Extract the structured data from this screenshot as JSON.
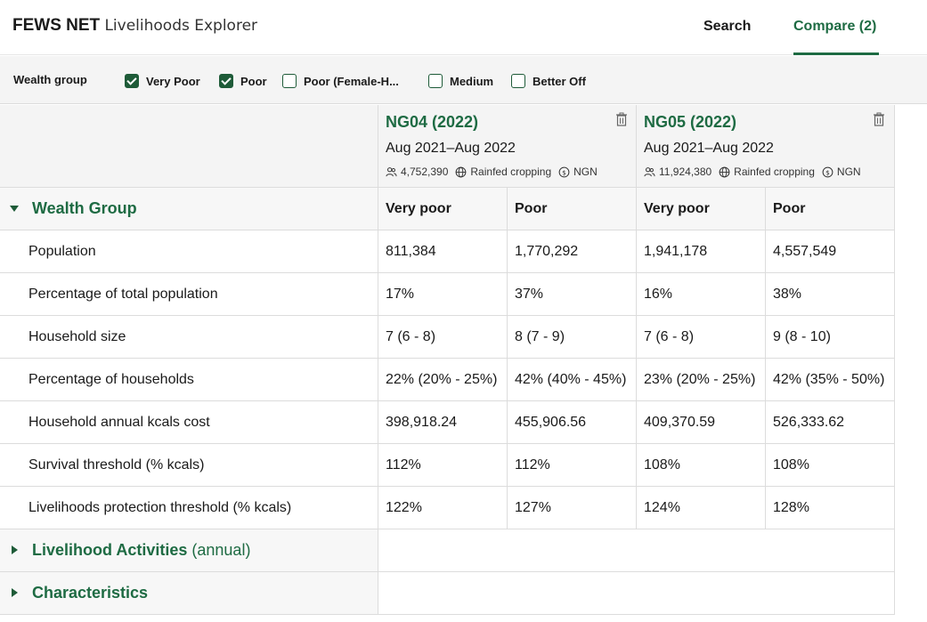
{
  "header": {
    "brand_bold": "FEWS NET",
    "brand_rest": "Livelihoods Explorer",
    "nav": {
      "search": "Search",
      "compare": "Compare (2)"
    }
  },
  "filter": {
    "label": "Wealth group",
    "options": [
      {
        "label": "Very Poor",
        "checked": true
      },
      {
        "label": "Poor",
        "checked": true
      },
      {
        "label": "Poor (Female-H...",
        "checked": false
      },
      {
        "label": "Medium",
        "checked": false
      },
      {
        "label": "Better Off",
        "checked": false
      }
    ]
  },
  "columns": [
    {
      "title": "NG04 (2022)",
      "dates": "Aug 2021–Aug 2022",
      "population": "4,752,390",
      "zone_type": "Rainfed cropping",
      "currency": "NGN"
    },
    {
      "title": "NG05 (2022)",
      "dates": "Aug 2021–Aug 2022",
      "population": "11,924,380",
      "zone_type": "Rainfed cropping",
      "currency": "NGN"
    }
  ],
  "wealth_section": {
    "title": "Wealth Group",
    "headers": [
      "Very poor",
      "Poor",
      "Very poor",
      "Poor"
    ],
    "rows": [
      {
        "label": "Population",
        "values": [
          "811,384",
          "1,770,292",
          "1,941,178",
          "4,557,549"
        ]
      },
      {
        "label": "Percentage of total population",
        "values": [
          "17%",
          "37%",
          "16%",
          "38%"
        ]
      },
      {
        "label": "Household size",
        "values": [
          "7 (6 - 8)",
          "8 (7 - 9)",
          "7 (6 - 8)",
          "9 (8 - 10)"
        ]
      },
      {
        "label": "Percentage of households",
        "values": [
          "22% (20% - 25%)",
          "42% (40% - 45%)",
          "23% (20% - 25%)",
          "42% (35% - 50%)"
        ]
      },
      {
        "label": "Household annual kcals cost",
        "values": [
          "398,918.24",
          "455,906.56",
          "409,370.59",
          "526,333.62"
        ]
      },
      {
        "label": "Survival threshold (% kcals)",
        "values": [
          "112%",
          "112%",
          "108%",
          "108%"
        ]
      },
      {
        "label": "Livelihoods protection threshold (% kcals)",
        "values": [
          "122%",
          "127%",
          "124%",
          "128%"
        ]
      }
    ]
  },
  "collapsed_sections": [
    {
      "title": "Livelihood Activities",
      "subtitle": "(annual)"
    },
    {
      "title": "Characteristics",
      "subtitle": ""
    }
  ],
  "colors": {
    "accent": "#1e6b43",
    "checkbox": "#1e5b38",
    "header_bg": "#f4f4f4"
  }
}
